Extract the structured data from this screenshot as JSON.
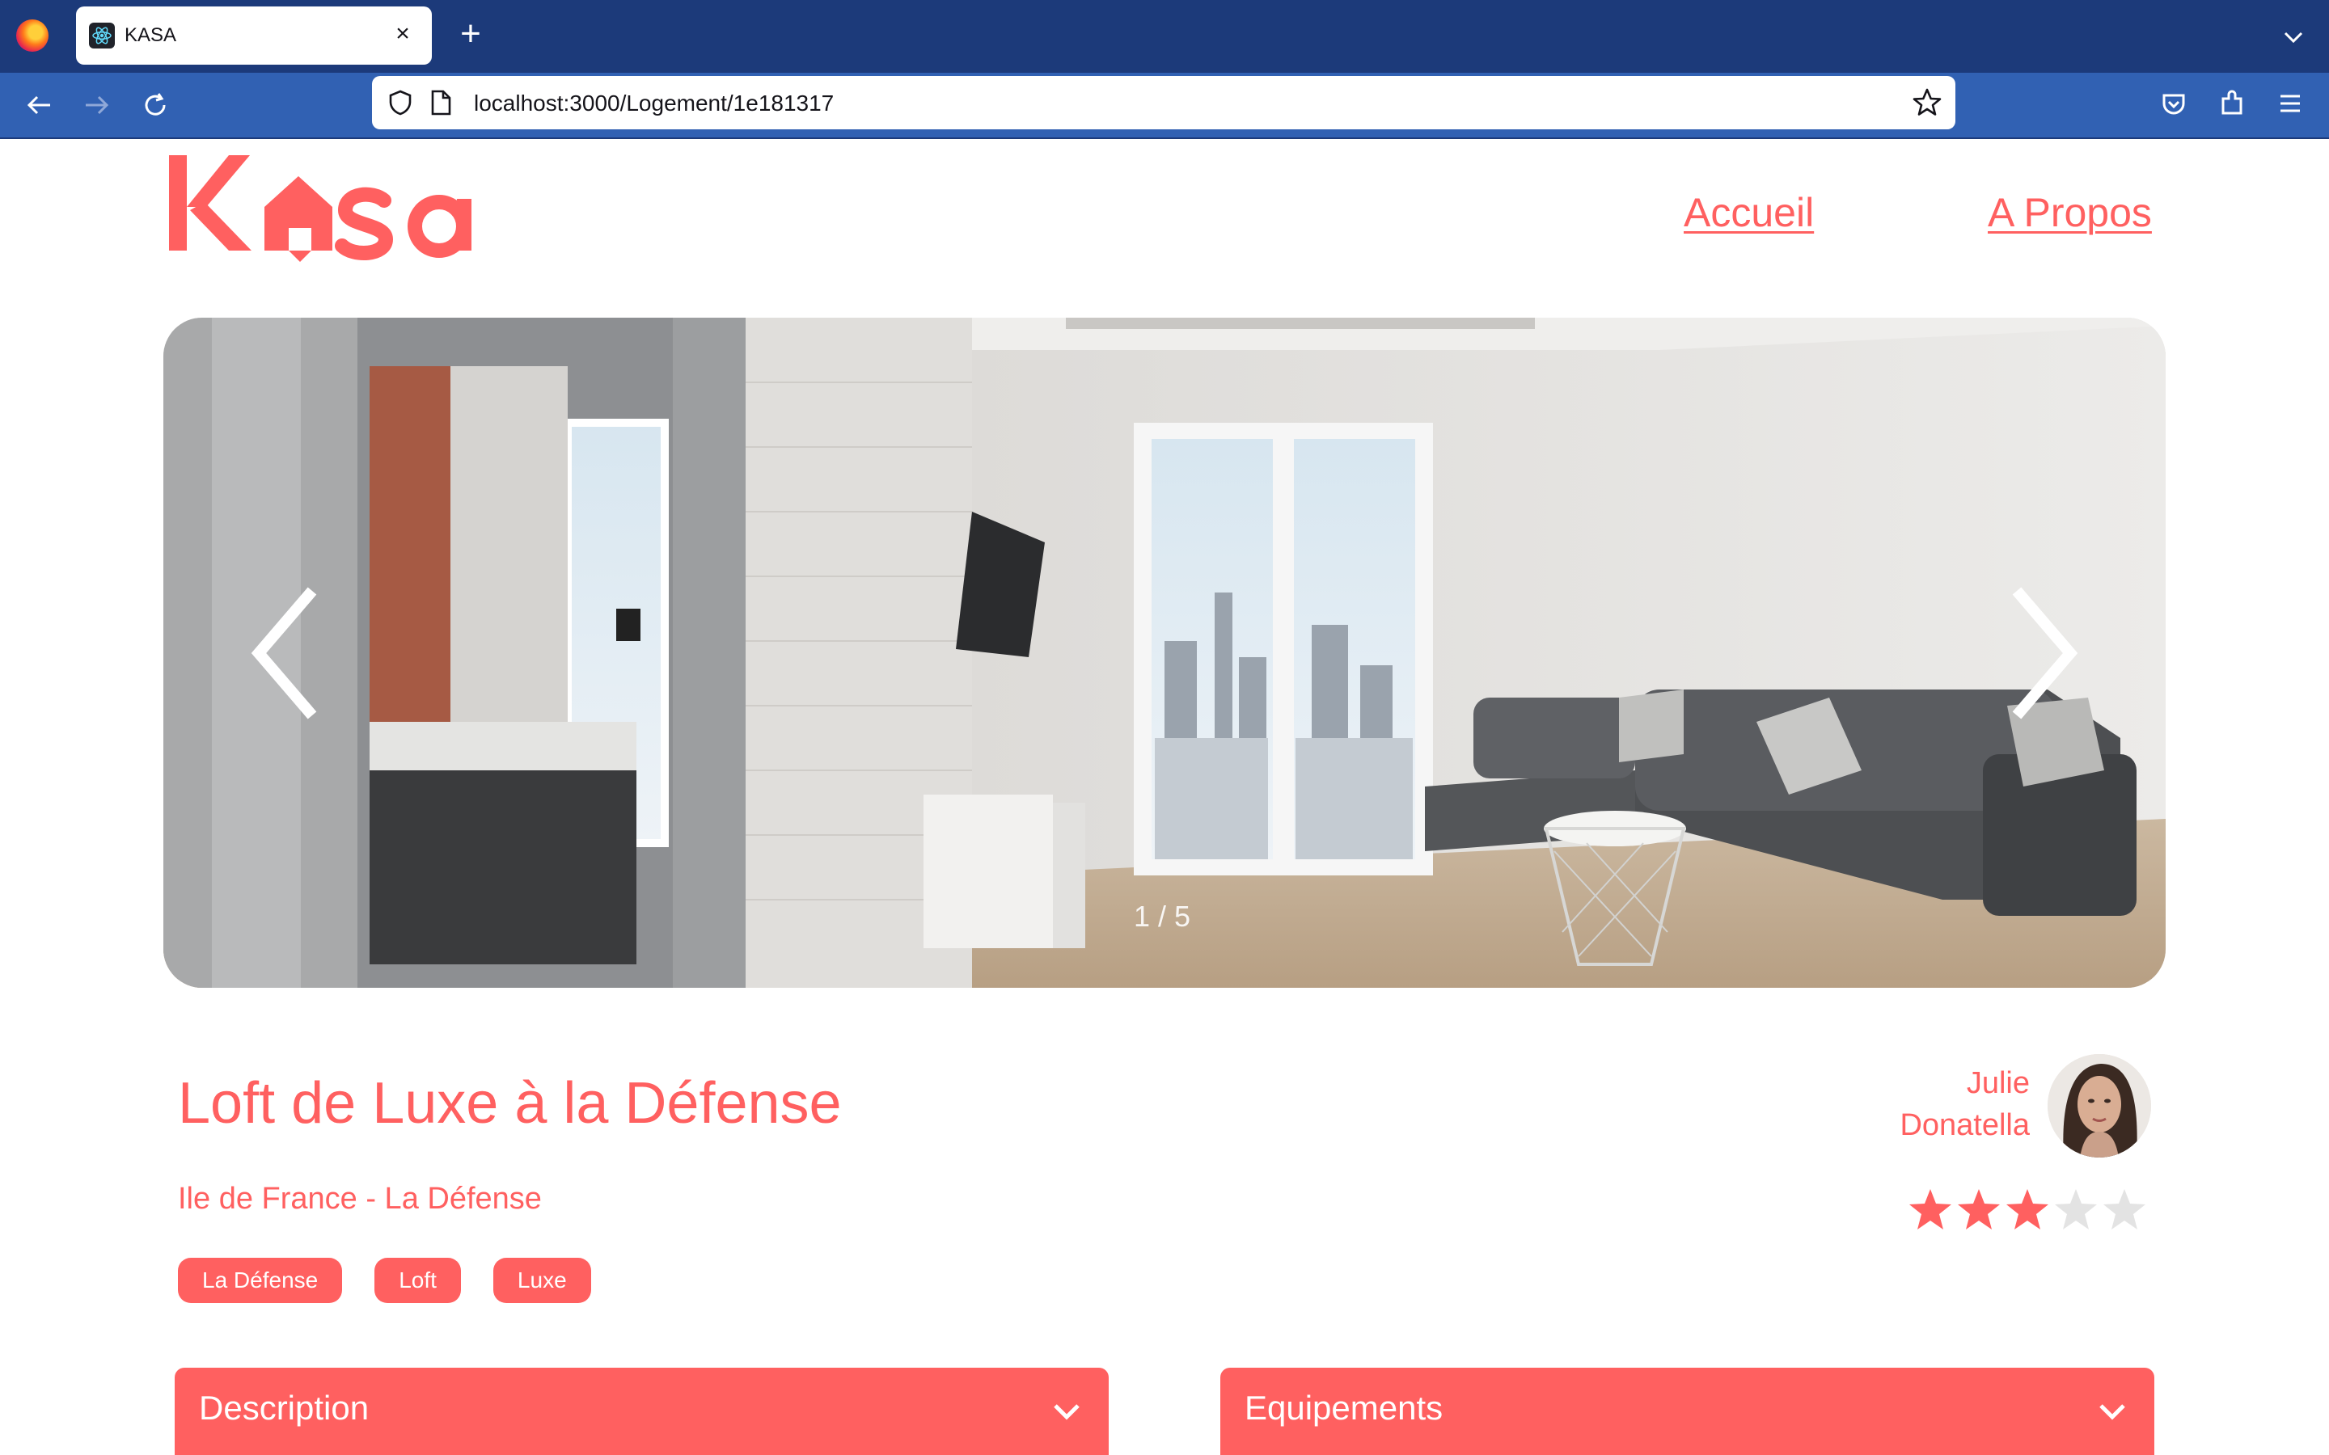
{
  "browser": {
    "tab_title": "KASA",
    "url_host": "localhost",
    "url_rest": ":3000/Logement/1e181317"
  },
  "header": {
    "logo_text": "Kasa",
    "nav": [
      {
        "label": "Accueil"
      },
      {
        "label": "A Propos"
      }
    ]
  },
  "carousel": {
    "counter": "1 / 5",
    "current": 1,
    "total": 5
  },
  "listing": {
    "title": "Loft de Luxe à la Défense",
    "location": "Ile de France - La Défense",
    "tags": [
      "La Défense",
      "Loft",
      "Luxe"
    ],
    "rating": 3,
    "rating_max": 5
  },
  "host": {
    "first_name": "Julie",
    "last_name": "Donatella"
  },
  "sections": [
    {
      "label": "Description"
    },
    {
      "label": "Equipements"
    }
  ],
  "colors": {
    "brand": "#ff6060",
    "star_off": "#e3e3e3"
  }
}
